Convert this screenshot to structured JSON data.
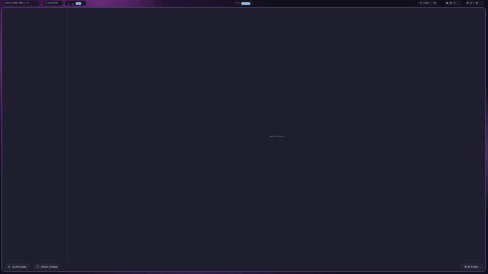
{
  "topbar": {
    "system_stats": "● 25 • 4.4GB • 48% • ↑ 5",
    "clock": "02:16 PM",
    "workspaces": [
      "1",
      "2",
      "3"
    ],
    "active_workspace": "3",
    "media_badge": "",
    "tray_time": "14:08",
    "tray_volume": "60",
    "colors": {
      "pill_bg": "#1b1927",
      "active_workspace": "#8fb7de",
      "heart": "#e06c8a"
    }
  },
  "window": {
    "placeholder": "Select a device",
    "buttons": {
      "quit": "Quit Solaar",
      "about": "About Solaar",
      "edit": "Rule Editor"
    }
  }
}
